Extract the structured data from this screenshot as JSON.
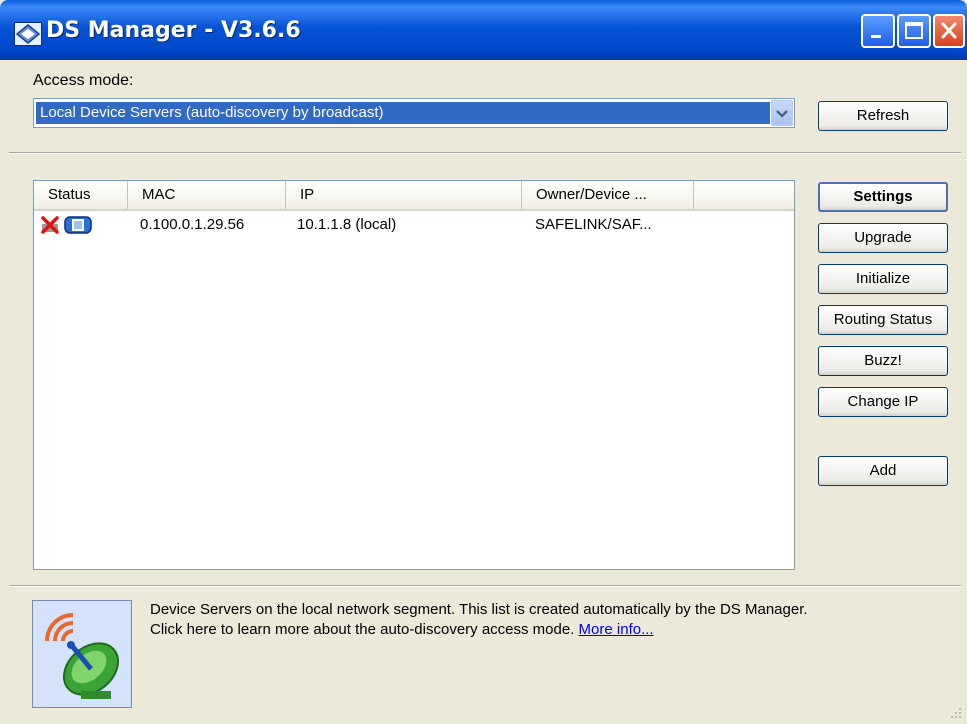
{
  "window": {
    "title": "DS Manager - V3.6.6"
  },
  "access": {
    "label": "Access mode:",
    "selected": "Local Device Servers (auto-discovery by broadcast)"
  },
  "buttons": {
    "refresh": "Refresh",
    "settings": "Settings",
    "upgrade": "Upgrade",
    "initialize": "Initialize",
    "routing_status": "Routing Status",
    "buzz": "Buzz!",
    "change_ip": "Change IP",
    "add": "Add"
  },
  "list": {
    "columns": [
      "Status",
      "MAC",
      "IP",
      "Owner/Device ..."
    ],
    "rows": [
      {
        "status_icons": [
          "red-x-icon",
          "device-server-icon"
        ],
        "mac": "0.100.0.1.29.56",
        "ip": "10.1.1.8 (local)",
        "owner": "SAFELINK/SAF..."
      }
    ]
  },
  "info": {
    "icon": "satellite-dish-icon",
    "line1": "Device Servers on the local network segment. This list is created automatically by the DS Manager.",
    "line2": "Click here to learn more about the auto-discovery access mode.",
    "link": "More info..."
  },
  "colors": {
    "titlebar": "#0054e3",
    "selection": "#316ac5",
    "window_bg": "#ece9d8",
    "link": "#0000ee",
    "close_button": "#d5401c"
  }
}
